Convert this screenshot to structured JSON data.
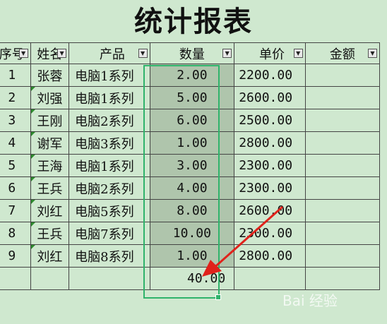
{
  "title": "统计报表",
  "headers": {
    "seq": "序号",
    "name": "姓名",
    "product": "产品",
    "qty": "数量",
    "price": "单价",
    "amount": "金额"
  },
  "rows": [
    {
      "seq": "1",
      "name": "张蓉",
      "product": "电脑1系列",
      "qty": "2.00",
      "price": "2200.00"
    },
    {
      "seq": "2",
      "name": "刘强",
      "product": "电脑1系列",
      "qty": "5.00",
      "price": "2600.00"
    },
    {
      "seq": "3",
      "name": "王刚",
      "product": "电脑2系列",
      "qty": "6.00",
      "price": "2500.00"
    },
    {
      "seq": "4",
      "name": "谢军",
      "product": "电脑3系列",
      "qty": "1.00",
      "price": "2800.00"
    },
    {
      "seq": "5",
      "name": "王海",
      "product": "电脑1系列",
      "qty": "3.00",
      "price": "2300.00"
    },
    {
      "seq": "6",
      "name": "王兵",
      "product": "电脑2系列",
      "qty": "4.00",
      "price": "2300.00"
    },
    {
      "seq": "7",
      "name": "刘红",
      "product": "电脑5系列",
      "qty": "8.00",
      "price": "2600.00"
    },
    {
      "seq": "8",
      "name": "王兵",
      "product": "电脑7系列",
      "qty": "10.00",
      "price": "2300.00"
    },
    {
      "seq": "9",
      "name": "刘红",
      "product": "电脑8系列",
      "qty": "1.00",
      "price": "2800.00"
    }
  ],
  "total": {
    "qty": "40.00"
  },
  "filter_icon": "dropdown-filter-icon",
  "watermark": "Bai 经验",
  "colors": {
    "background": "#cfe8cf",
    "selection": "#afc5ac",
    "selection_border": "#2fb36b",
    "arrow": "#e0221b"
  }
}
